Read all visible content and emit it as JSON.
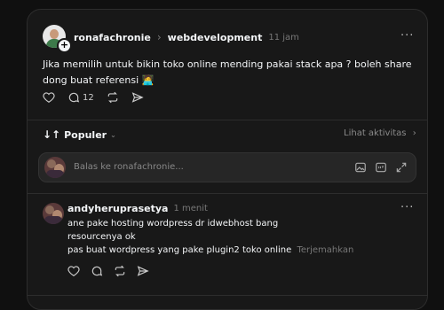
{
  "post": {
    "username": "ronafachronie",
    "separator": "›",
    "community": "webdevelopment",
    "time": "11 jam",
    "more": "···",
    "text": "Jika memilih untuk bikin toko online mending pakai stack apa ? boleh share dong buat referensi",
    "emoji": "🧑‍💻",
    "reply_count": "12"
  },
  "sort": {
    "label": "Populer",
    "activity_link": "Lihat aktivitas"
  },
  "reply_box": {
    "placeholder": "Balas ke ronafachronie..."
  },
  "reply": {
    "username": "andyheruprasetya",
    "time": "1 menit",
    "more": "···",
    "lines": [
      "ane pake hosting wordpress dr idwebhost bang",
      "resourcenya ok",
      "pas buat wordpress yang pake plugin2 toko online"
    ],
    "translate": "Terjemahkan"
  }
}
